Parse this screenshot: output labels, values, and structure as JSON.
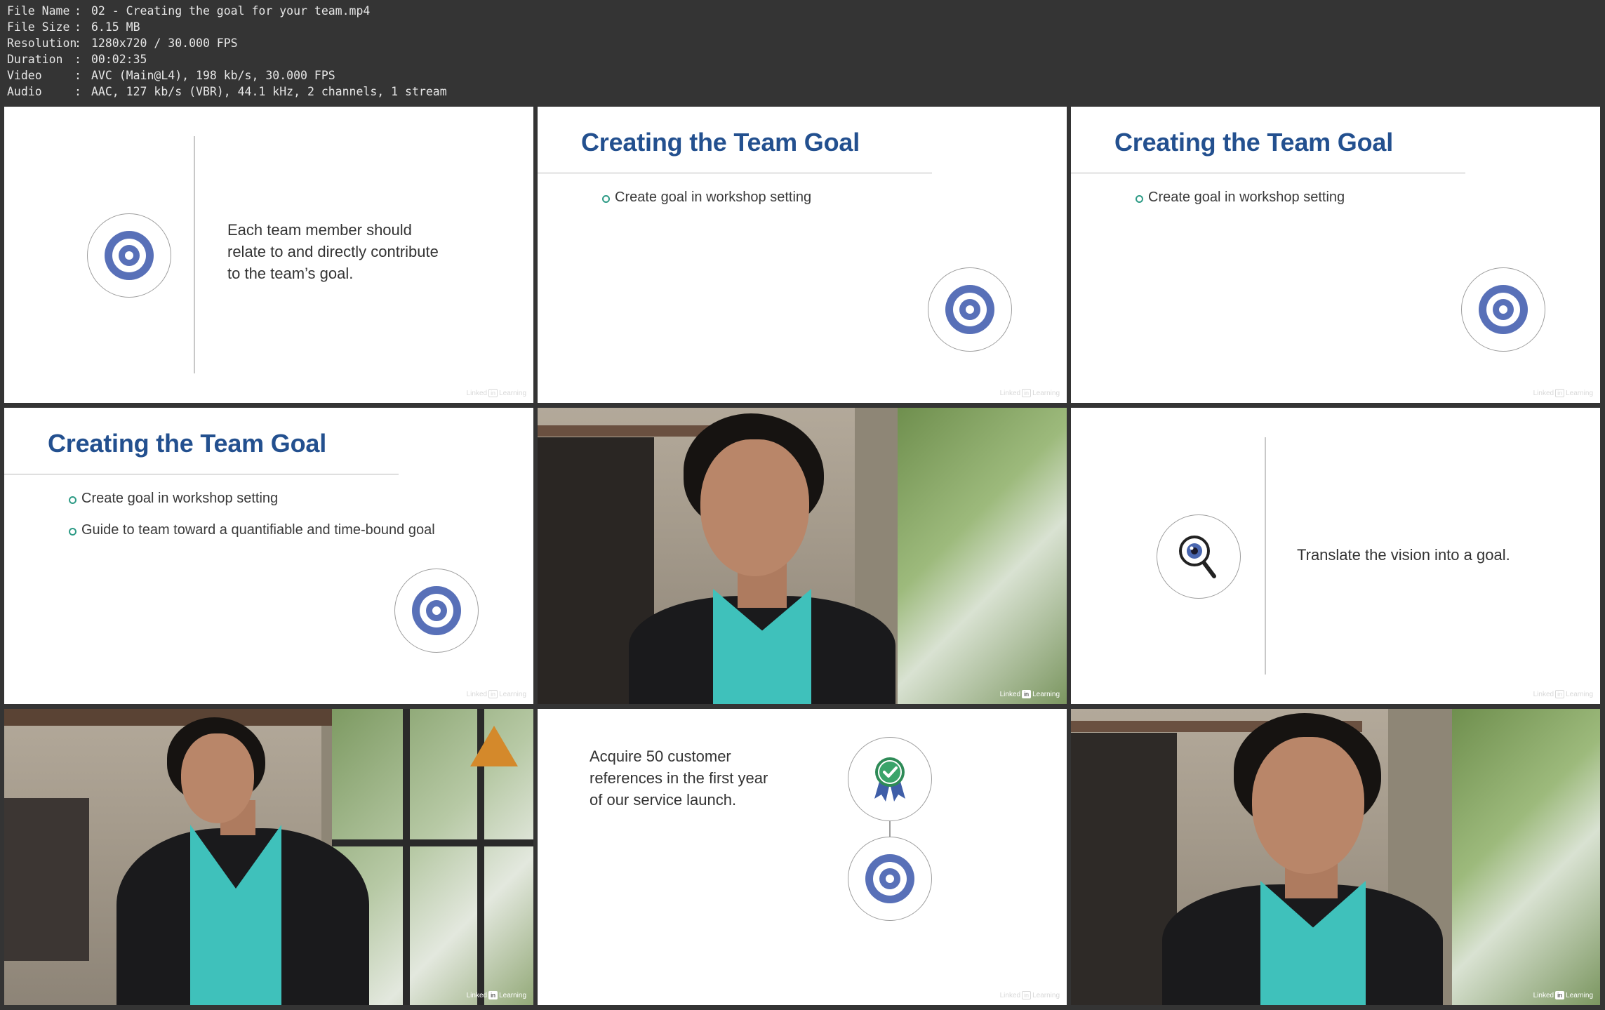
{
  "file_info": [
    {
      "label": "File Name",
      "value": "02 - Creating the goal for your team.mp4"
    },
    {
      "label": "File Size",
      "value": "6.15 MB"
    },
    {
      "label": "Resolution",
      "value": "1280x720 / 30.000 FPS"
    },
    {
      "label": "Duration",
      "value": "00:02:35"
    },
    {
      "label": "Video",
      "value": "AVC (Main@L4), 198 kb/s, 30.000 FPS"
    },
    {
      "label": "Audio",
      "value": "AAC, 127 kb/s (VBR), 44.1 kHz, 2 channels, 1 stream"
    }
  ],
  "separator": ":",
  "brand": {
    "linked": "Linked",
    "in": "in",
    "learning": "Learning"
  },
  "slides": {
    "s1": {
      "text": [
        "Each team member should",
        "relate to and directly contribute",
        "to the team’s goal."
      ]
    },
    "s2": {
      "title": "Creating the Team Goal",
      "bullets": [
        "Create goal in workshop setting"
      ]
    },
    "s3": {
      "title": "Creating the Team Goal",
      "bullets": [
        "Create goal in workshop setting"
      ]
    },
    "s4": {
      "title": "Creating the Team Goal",
      "bullets": [
        "Create goal in workshop setting",
        "Guide to team toward a quantifiable and time-bound goal"
      ]
    },
    "s6": {
      "text": [
        "Translate the vision into a goal."
      ]
    },
    "s8": {
      "text": [
        "Acquire 50 customer",
        "references in the first year",
        "of our service launch."
      ]
    }
  },
  "colors": {
    "title": "#23508f",
    "target": "#5870b8",
    "bullet": "#2e9b86",
    "award": "#2e8b57"
  },
  "icons": [
    "target-icon",
    "magnifier-eye-icon",
    "award-ribbon-icon"
  ]
}
